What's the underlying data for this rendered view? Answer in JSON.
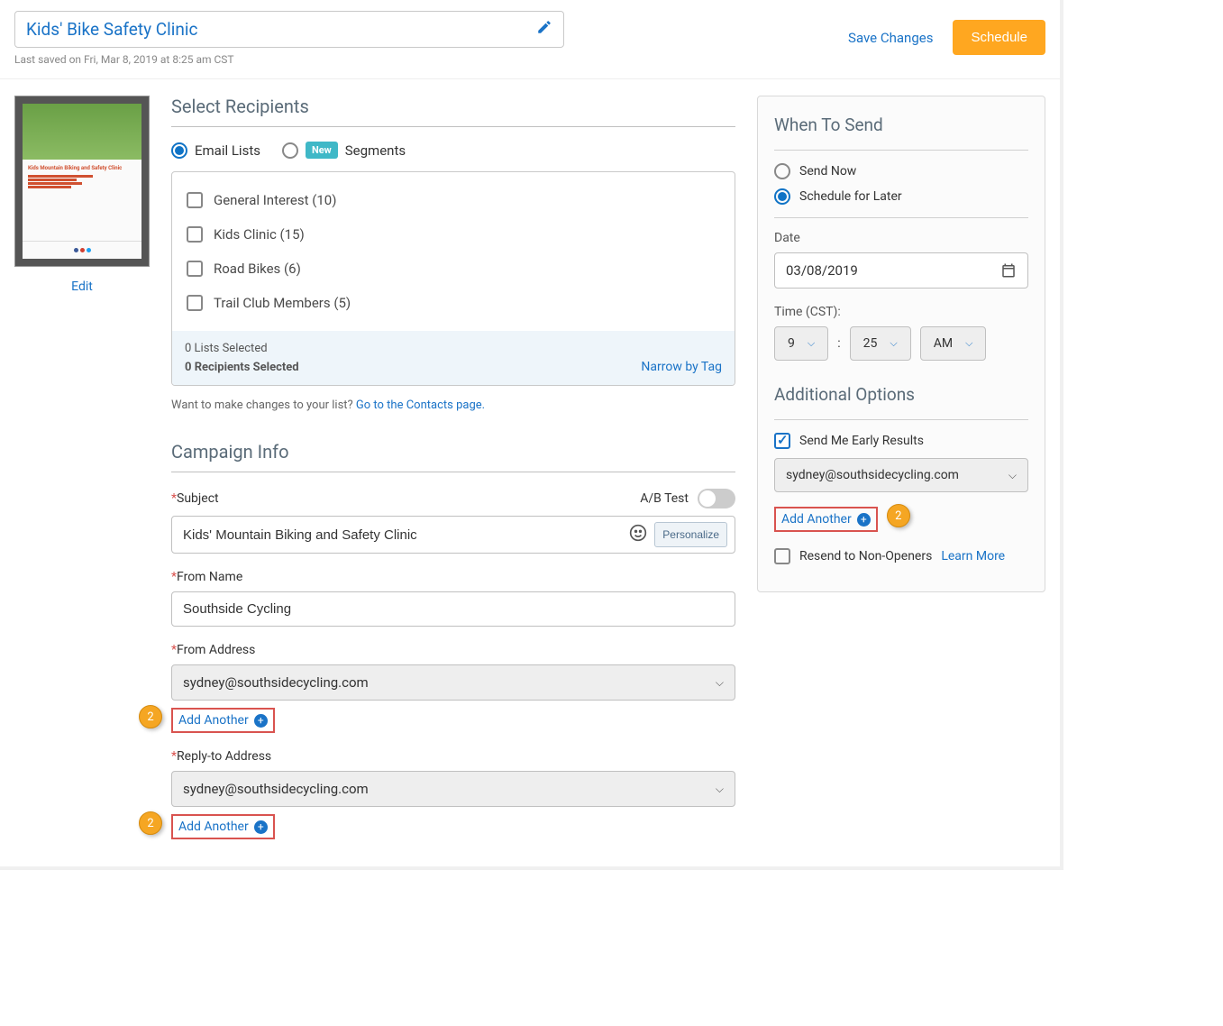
{
  "header": {
    "title": "Kids' Bike Safety Clinic",
    "last_saved": "Last saved on Fri, Mar 8, 2019 at 8:25 am CST",
    "save_changes": "Save Changes",
    "schedule": "Schedule"
  },
  "thumb": {
    "edit": "Edit",
    "preview_title": "Kids Mountain Biking and Safety Clinic"
  },
  "recipients": {
    "heading": "Select Recipients",
    "email_lists_label": "Email Lists",
    "new_badge": "New",
    "segments_label": "Segments",
    "lists": [
      "General Interest (10)",
      "Kids Clinic (15)",
      "Road Bikes (6)",
      "Trail Club Members (5)"
    ],
    "lists_selected": "0 Lists Selected",
    "recipients_selected": "0 Recipients Selected",
    "narrow": "Narrow by Tag",
    "hint_text": "Want to make changes to your list? ",
    "hint_link": "Go to the Contacts page."
  },
  "campaign": {
    "heading": "Campaign Info",
    "subject_label": "Subject",
    "abtest_label": "A/B Test",
    "subject_value": "Kids' Mountain Biking and Safety Clinic",
    "personalize": "Personalize",
    "from_name_label": "From Name",
    "from_name_value": "Southside Cycling",
    "from_address_label": "From Address",
    "from_address_value": "sydney@southsidecycling.com",
    "reply_to_label": "Reply-to Address",
    "reply_to_value": "sydney@southsidecycling.com",
    "add_another": "Add Another",
    "callout": "2"
  },
  "send": {
    "heading": "When To Send",
    "send_now": "Send Now",
    "schedule_later": "Schedule for Later",
    "date_label": "Date",
    "date_value": "03/08/2019",
    "time_label": "Time (CST):",
    "hour": "9",
    "minute": "25",
    "ampm": "AM",
    "additional": "Additional Options",
    "early_results": "Send Me Early Results",
    "early_email": "sydney@southsidecycling.com",
    "add_another": "Add Another",
    "callout": "2",
    "resend_label": "Resend to Non-Openers",
    "learn_more": "Learn More"
  }
}
